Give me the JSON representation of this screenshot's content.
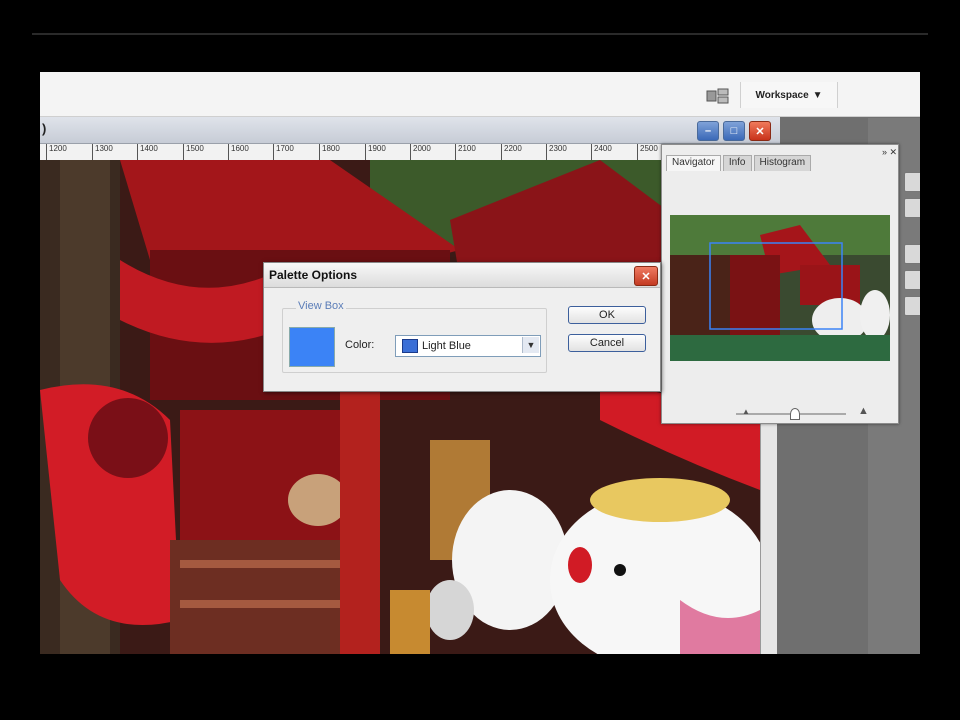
{
  "optionbar": {
    "workspace_label": "Workspace",
    "workspace_arrow": "▼"
  },
  "document": {
    "title_fragment": ")",
    "ruler_ticks": [
      "1200",
      "1300",
      "1400",
      "1500",
      "1600",
      "1700",
      "1800",
      "1900",
      "2000",
      "2100",
      "2200",
      "2300",
      "2400",
      "2500"
    ],
    "window_buttons": {
      "minimize": "–",
      "maximize": "□",
      "close": "✕"
    }
  },
  "navigator": {
    "tabs": [
      "Navigator",
      "Info",
      "Histogram"
    ],
    "close_glyph": "» ✕",
    "zoom_out_glyph": "▲",
    "zoom_in_glyph": "▲"
  },
  "dialog": {
    "title": "Palette Options",
    "close_glyph": "✕",
    "group_label": "View Box",
    "color_label": "Color:",
    "color_value": "Light Blue",
    "select_arrow": "▼",
    "ok_label": "OK",
    "cancel_label": "Cancel",
    "swatch_color": "#3b83f6"
  }
}
